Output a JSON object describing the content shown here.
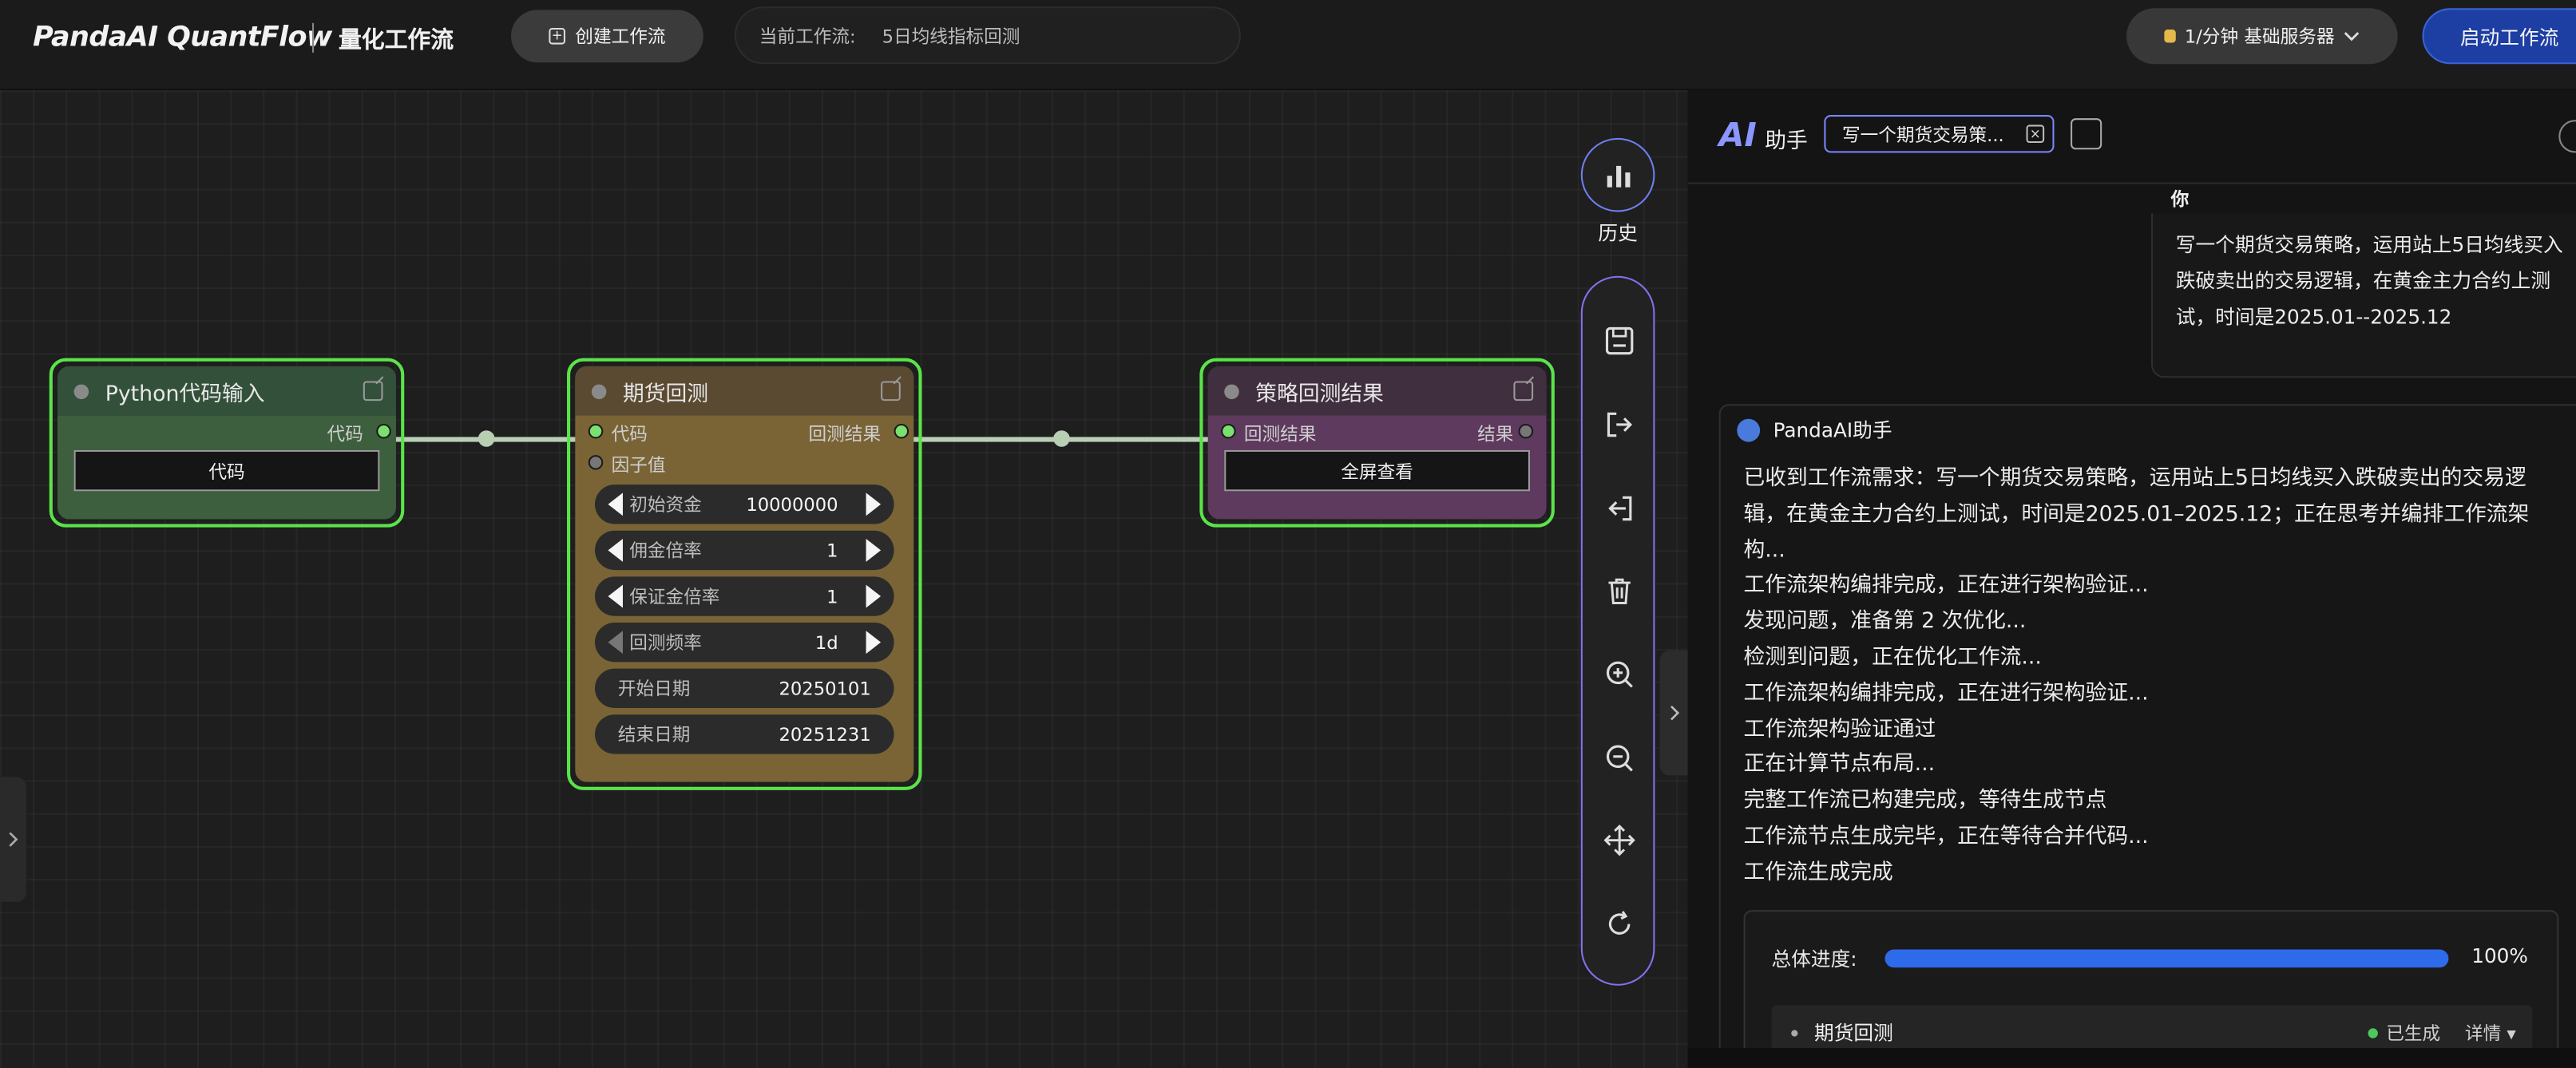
{
  "header": {
    "logo": "PandaAI QuantFlow",
    "subtitle": "量化工作流",
    "create_label": "创建工作流",
    "current_wf_label": "当前工作流:",
    "current_wf_value": "5日均线指标回测",
    "server_label": "1/分钟  基础服务器",
    "start_label": "启动工作流"
  },
  "nodes": {
    "python": {
      "title": "Python代码输入",
      "out_port": "代码",
      "button": "代码"
    },
    "futures": {
      "title": "期货回测",
      "in_port_code": "代码",
      "in_port_factor": "因子值",
      "out_port": "回测结果",
      "params": [
        {
          "label": "初始资金",
          "value": "10000000"
        },
        {
          "label": "佣金倍率",
          "value": "1"
        },
        {
          "label": "保证金倍率",
          "value": "1"
        },
        {
          "label": "回测频率",
          "value": "1d"
        },
        {
          "label": "开始日期",
          "value": "20250101"
        },
        {
          "label": "结束日期",
          "value": "20251231"
        }
      ]
    },
    "result": {
      "title": "策略回测结果",
      "in_port": "回测结果",
      "out_port": "结果",
      "button": "全屏查看"
    }
  },
  "toolbar": {
    "history_label": "历史",
    "icons": [
      "save-icon",
      "export-icon",
      "import-icon",
      "delete-icon",
      "zoom-in-icon",
      "zoom-out-icon",
      "move-icon",
      "refresh-icon"
    ]
  },
  "assistant": {
    "title": "助手",
    "chip": "写一个期货交易策...",
    "user_label": "你",
    "user_message": "写一个期货交易策略，运用站上5日均线买入跌破卖出的交易逻辑，在黄金主力合约上测试，时间是2025.01--2025.12",
    "bot_name": "PandaAI助手",
    "bot_lines": [
      "已收到工作流需求：写一个期货交易策略，运用站上5日均线买入跌破卖出的交易逻辑，在黄金主力合约上测试，时间是2025.01–2025.12；正在思考并编排工作流架构...",
      "工作流架构编排完成，正在进行架构验证...",
      "发现问题，准备第 2 次优化...",
      "检测到问题，正在优化工作流...",
      "工作流架构编排完成，正在进行架构验证...",
      "工作流架构验证通过",
      "正在计算节点布局...",
      "完整工作流已构建完成，等待生成节点",
      "工作流节点生成完毕，正在等待合并代码...",
      "工作流生成完成"
    ],
    "progress_label": "总体进度:",
    "progress_value": 100,
    "progress_text": "100%",
    "task_name": "期货回测",
    "task_status": "已生成",
    "task_detail": "详情 ▾"
  },
  "colors": {
    "accent": "#2e6bea",
    "node_border": "#5be34a",
    "python_node": "#3a5a3a",
    "futures_node": "#7a6436",
    "result_node": "#5e3a5e"
  }
}
